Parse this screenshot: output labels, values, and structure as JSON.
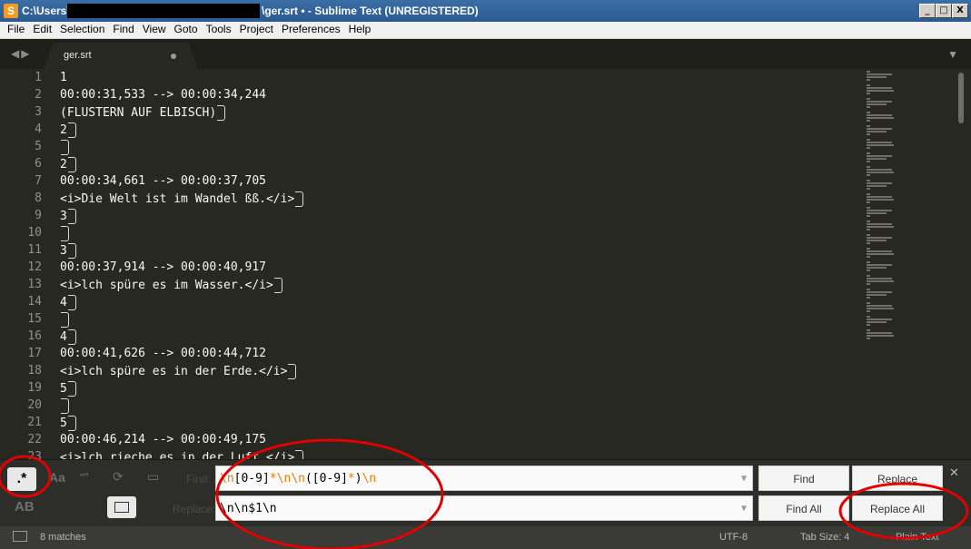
{
  "window": {
    "title_left": "C:\\Users\\",
    "title_right": "\\ger.srt • - Sublime Text (UNREGISTERED)",
    "buttons": [
      "_",
      "□",
      "X"
    ]
  },
  "menu": [
    "File",
    "Edit",
    "Selection",
    "Find",
    "View",
    "Goto",
    "Tools",
    "Project",
    "Preferences",
    "Help"
  ],
  "tab": {
    "label": "ger.srt"
  },
  "editor": {
    "lines": [
      {
        "n": "1",
        "text": "1",
        "nl": false
      },
      {
        "n": "2",
        "text": "00:00:31,533 --> 00:00:34,244",
        "nl": false
      },
      {
        "n": "3",
        "text": "(FLUSTERN AUF ELBISCH)",
        "nl": true
      },
      {
        "n": "4",
        "text": "2",
        "nl": true
      },
      {
        "n": "5",
        "text": "",
        "nl": true
      },
      {
        "n": "6",
        "text": "2",
        "nl": true
      },
      {
        "n": "7",
        "text": "00:00:34,661 --> 00:00:37,705",
        "nl": false
      },
      {
        "n": "8",
        "text": "<i>Die Welt ist im Wandel ßß.</i>",
        "nl": true
      },
      {
        "n": "9",
        "text": "3",
        "nl": true
      },
      {
        "n": "10",
        "text": "",
        "nl": true
      },
      {
        "n": "11",
        "text": "3",
        "nl": true
      },
      {
        "n": "12",
        "text": "00:00:37,914 --> 00:00:40,917",
        "nl": false
      },
      {
        "n": "13",
        "text": "<i>lch spüre es im Wasser.</i>",
        "nl": true
      },
      {
        "n": "14",
        "text": "4",
        "nl": true
      },
      {
        "n": "15",
        "text": "",
        "nl": true
      },
      {
        "n": "16",
        "text": "4",
        "nl": true
      },
      {
        "n": "17",
        "text": "00:00:41,626 --> 00:00:44,712",
        "nl": false
      },
      {
        "n": "18",
        "text": "<i>lch spüre es in der Erde.</i>",
        "nl": true
      },
      {
        "n": "19",
        "text": "5",
        "nl": true
      },
      {
        "n": "20",
        "text": "",
        "nl": true
      },
      {
        "n": "21",
        "text": "5",
        "nl": true
      },
      {
        "n": "22",
        "text": "00:00:46,214 --> 00:00:49,175",
        "nl": false
      },
      {
        "n": "23",
        "text": "<i>lch rieche es in der Luft.</i>",
        "nl": true
      }
    ]
  },
  "find_panel": {
    "options": {
      "regex": ".*",
      "case": "Aa",
      "whole_word": "“”",
      "wrap": "⟳",
      "in_selection": "▭",
      "preserve_case": "AB"
    },
    "find_label": "Find:",
    "find_tokens": [
      {
        "t": "\\n",
        "c": "#e87d0d"
      },
      {
        "t": "[0-9]",
        "c": "#000000"
      },
      {
        "t": "*",
        "c": "#e87d0d"
      },
      {
        "t": "\\n\\n",
        "c": "#e87d0d"
      },
      {
        "t": "(",
        "c": "#000000"
      },
      {
        "t": "[0-9]",
        "c": "#000000"
      },
      {
        "t": "*",
        "c": "#e87d0d"
      },
      {
        "t": ")",
        "c": "#000000"
      },
      {
        "t": "\\n",
        "c": "#e87d0d"
      }
    ],
    "replace_label": "Replace:",
    "replace_value": "\\n\\n$1\\n",
    "buttons": {
      "find": "Find",
      "replace": "Replace",
      "find_all": "Find All",
      "replace_all": "Replace All"
    }
  },
  "status": {
    "matches": "8 matches",
    "encoding": "UTF-8",
    "tab_size": "Tab Size: 4",
    "syntax": "Plain Text"
  },
  "colors": {
    "editor_bg": "#272822",
    "annotation": "#e00000",
    "regex_accent": "#e87d0d"
  }
}
